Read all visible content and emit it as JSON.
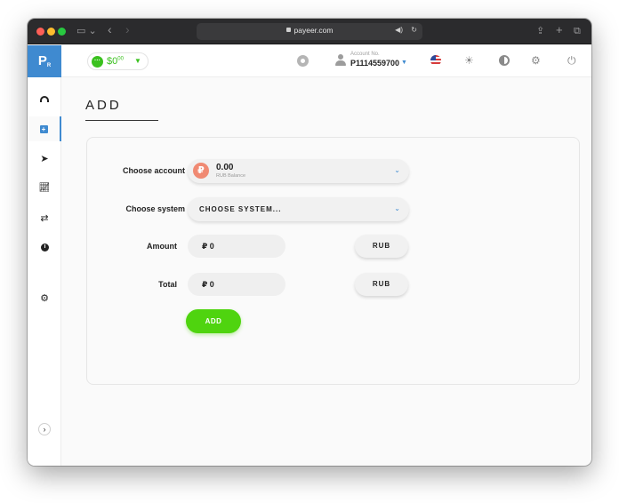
{
  "browser": {
    "url": "payeer.com",
    "nav_back": "‹",
    "nav_forward": "›",
    "sidebar_toggle": "▭ ⌄"
  },
  "header": {
    "balance": "$0",
    "balance_cents": "00",
    "account_label": "Account No.",
    "account_number": "P1114559700"
  },
  "logo": {
    "letter": "P",
    "sub": "R"
  },
  "page": {
    "title": "ADD"
  },
  "form": {
    "account_label": "Choose account",
    "account_amount": "0.00",
    "account_sub": "RUB Balance",
    "account_currency_symbol": "₽",
    "system_label": "Choose system",
    "system_placeholder": "CHOOSE SYSTEM...",
    "amount_label": "Amount",
    "amount_value": "₽ 0",
    "amount_currency": "RUB",
    "total_label": "Total",
    "total_value": "₽ 0",
    "total_currency": "RUB",
    "submit_label": "ADD"
  },
  "colors": {
    "accent": "#3f8ad0",
    "success": "#4fd40f",
    "balance_green": "#3ac11e",
    "ruble_badge": "#f08a73"
  }
}
